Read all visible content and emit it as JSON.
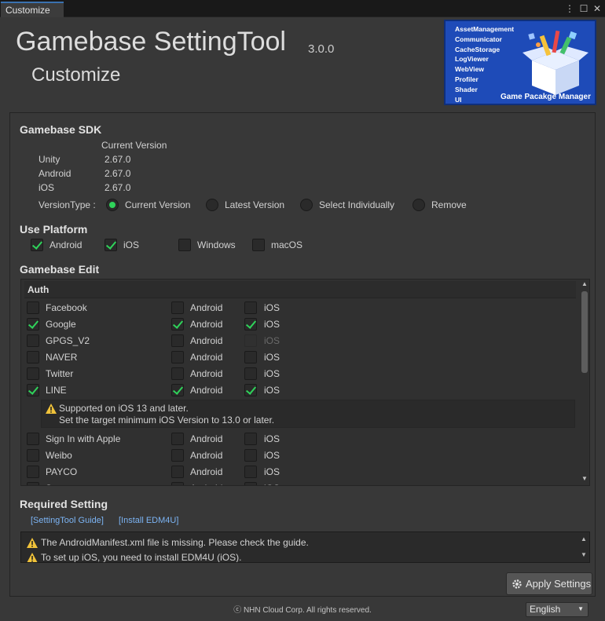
{
  "window": {
    "tab_title": "Customize"
  },
  "header": {
    "title": "Gamebase SettingTool",
    "version": "3.0.0",
    "subtitle": "Customize"
  },
  "banner": {
    "items": [
      "AssetManagement",
      "Communicator",
      "CacheStorage",
      "LogViewer",
      "WebView",
      "Profiler",
      "Shader",
      "UI"
    ],
    "caption": "Game Pacakge Manager",
    "color": "#1e4bb8"
  },
  "sdk": {
    "heading": "Gamebase SDK",
    "current_version_label": "Current Version",
    "rows": [
      {
        "platform": "Unity",
        "version": "2.67.0"
      },
      {
        "platform": "Android",
        "version": "2.67.0"
      },
      {
        "platform": "iOS",
        "version": "2.67.0"
      }
    ],
    "version_type_label": "VersionType :",
    "version_types": [
      "Current Version",
      "Latest Version",
      "Select Individually",
      "Remove"
    ],
    "selected_version_type": "Current Version"
  },
  "platform": {
    "heading": "Use Platform",
    "options": [
      {
        "label": "Android",
        "checked": true
      },
      {
        "label": "iOS",
        "checked": true
      },
      {
        "label": "Windows",
        "checked": false
      },
      {
        "label": "macOS",
        "checked": false
      }
    ]
  },
  "edit": {
    "heading": "Gamebase Edit",
    "group": "Auth",
    "android_label": "Android",
    "ios_label": "iOS",
    "items": [
      {
        "name": "Facebook",
        "checked": false,
        "android": false,
        "ios": false
      },
      {
        "name": "Google",
        "checked": true,
        "android": true,
        "ios": true
      },
      {
        "name": "GPGS_V2",
        "checked": false,
        "android": false,
        "ios": false,
        "ios_disabled": true
      },
      {
        "name": "NAVER",
        "checked": false,
        "android": false,
        "ios": false
      },
      {
        "name": "Twitter",
        "checked": false,
        "android": false,
        "ios": false
      },
      {
        "name": "LINE",
        "checked": true,
        "android": true,
        "ios": true
      },
      {
        "name": "Sign In with Apple",
        "checked": false,
        "android": false,
        "ios": false
      },
      {
        "name": "Weibo",
        "checked": false,
        "android": false,
        "ios": false
      },
      {
        "name": "PAYCO",
        "checked": false,
        "android": false,
        "ios": false
      },
      {
        "name": "Steam",
        "checked": false,
        "android": false,
        "ios": false
      }
    ],
    "line_notice": [
      "Supported on iOS 13 and later.",
      "Set the target minimum iOS Version to 13.0 or later."
    ]
  },
  "required": {
    "heading": "Required Setting",
    "links": [
      "[SettingTool Guide]",
      "[Install EDM4U]"
    ],
    "messages": [
      "The AndroidManifest.xml file is missing. Please check the guide.",
      "To set up iOS, you need to install EDM4U (iOS)."
    ]
  },
  "actions": {
    "apply_label": "Apply Settings"
  },
  "footer": {
    "copyright": "ⓒ NHN Cloud Corp. All rights reserved.",
    "language": "English"
  },
  "colors": {
    "accent_check": "#2fd35a",
    "link": "#7cb4f4",
    "warn": "#f0c23a"
  }
}
